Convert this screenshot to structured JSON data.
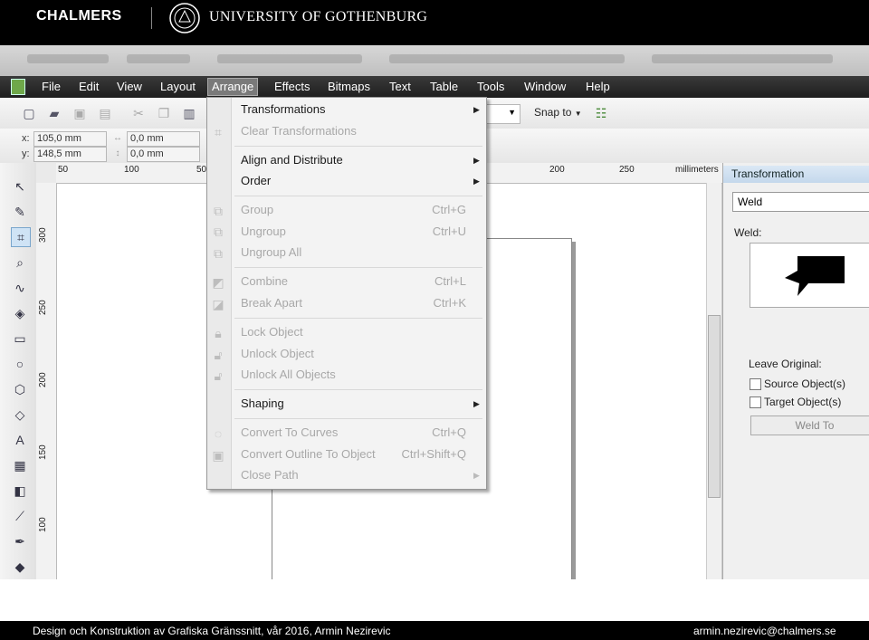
{
  "header": {
    "left_logo": "CHALMERS",
    "right_logo": "UNIVERSITY OF GOTHENBURG"
  },
  "menubar": {
    "items": [
      "File",
      "Edit",
      "View",
      "Layout",
      "Arrange",
      "Effects",
      "Bitmaps",
      "Text",
      "Table",
      "Tools",
      "Window",
      "Help"
    ],
    "active": "Arrange"
  },
  "toolbar": {
    "x_label": "x:",
    "x_value": "105,0 mm",
    "y_label": "y:",
    "y_value": "148,5 mm",
    "w_value": "0,0 mm",
    "h_value": "0,0 mm",
    "snap_to": "Snap to"
  },
  "ruler": {
    "h_ticks": [
      "50",
      "100",
      "50",
      "200",
      "250"
    ],
    "unit": "millimeters",
    "v_ticks": [
      "300",
      "250",
      "200",
      "150",
      "100"
    ]
  },
  "arrange_menu": {
    "transformations": "Transformations",
    "clear_transformations": "Clear Transformations",
    "align_and_distribute": "Align and Distribute",
    "order": "Order",
    "group": "Group",
    "group_shortcut": "Ctrl+G",
    "ungroup": "Ungroup",
    "ungroup_shortcut": "Ctrl+U",
    "ungroup_all": "Ungroup All",
    "combine": "Combine",
    "combine_shortcut": "Ctrl+L",
    "break_apart": "Break  Apart",
    "break_apart_shortcut": "Ctrl+K",
    "lock_object": "Lock Object",
    "unlock_object": "Unlock Object",
    "unlock_all_objects": "Unlock All Objects",
    "shaping": "Shaping",
    "convert_to_curves": "Convert To Curves",
    "convert_to_curves_shortcut": "Ctrl+Q",
    "convert_outline": "Convert Outline To Object",
    "convert_outline_shortcut": "Ctrl+Shift+Q",
    "close_path": "Close Path"
  },
  "docker": {
    "title": "Transformation",
    "mode": "Weld",
    "weld_label": "Weld:",
    "leave_original": "Leave Original:",
    "source_objects": "Source Object(s)",
    "target_objects": "Target Object(s)",
    "weld_to_button": "Weld To"
  },
  "footer": {
    "left": "Design och Konstruktion av Grafiska Gränssnitt,  vår 2016, Armin Nezirevic",
    "right": "armin.nezirevic@chalmers.se"
  }
}
